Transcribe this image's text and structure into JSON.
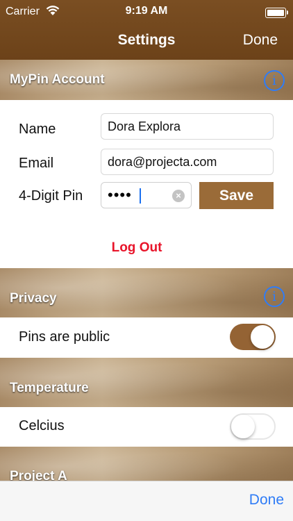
{
  "status_bar": {
    "carrier": "Carrier",
    "time": "9:19 AM"
  },
  "nav": {
    "title": "Settings",
    "done_label": "Done"
  },
  "account": {
    "header": "MyPin Account",
    "name_label": "Name",
    "name_value": "Dora Explora",
    "email_label": "Email",
    "email_value": "dora@projecta.com",
    "pin_label": "4-Digit Pin",
    "pin_masked": "••••",
    "save_label": "Save",
    "logout_label": "Log Out"
  },
  "privacy": {
    "header": "Privacy",
    "pins_public_label": "Pins are public",
    "pins_public_on": true
  },
  "temperature": {
    "header": "Temperature",
    "celcius_label": "Celcius",
    "celcius_on": false
  },
  "project": {
    "header": "Project A"
  },
  "toolbar": {
    "done_label": "Done"
  },
  "colors": {
    "brand_brown": "#6c4219",
    "accent_blue": "#2f7cf6",
    "logout_red": "#e8142a",
    "save_brown": "#9a6b38"
  },
  "icons": [
    "wifi-icon",
    "battery-icon",
    "info-icon",
    "clear-icon"
  ]
}
